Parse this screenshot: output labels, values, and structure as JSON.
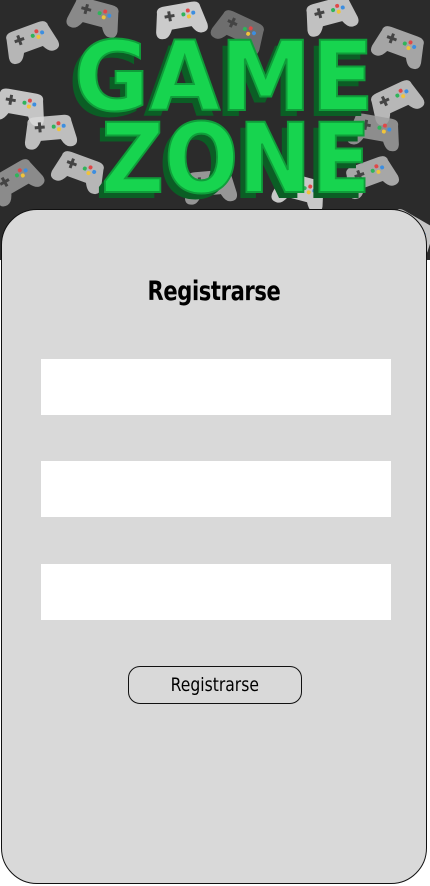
{
  "banner": {
    "logo_line_1": "GAME",
    "logo_line_2": "ZONE",
    "background_color": "#2b2b2b",
    "logo_color": "#17d44f",
    "pattern_icon": "gamepad-icon"
  },
  "form": {
    "title": "Registrarse",
    "fields": [
      {
        "value": "",
        "placeholder": ""
      },
      {
        "value": "",
        "placeholder": ""
      },
      {
        "value": "",
        "placeholder": ""
      }
    ],
    "submit_label": "Registrarse"
  },
  "colors": {
    "card_background": "#d9d9d9",
    "field_background": "#ffffff",
    "border": "#111111"
  }
}
